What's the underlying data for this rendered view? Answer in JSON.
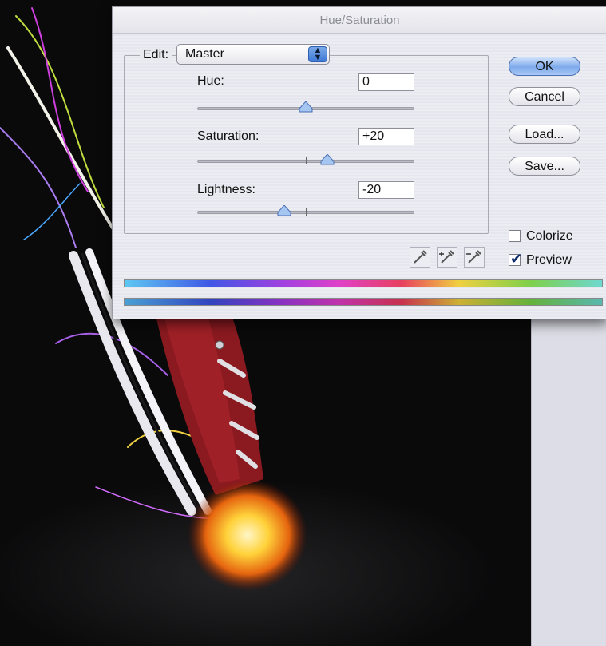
{
  "dialog": {
    "title": "Hue/Saturation",
    "edit_label": "Edit:",
    "edit_value": "Master",
    "hue": {
      "label": "Hue:",
      "value": "0",
      "position": 0.5
    },
    "saturation": {
      "label": "Saturation:",
      "value": "+20",
      "position": 0.6
    },
    "lightness": {
      "label": "Lightness:",
      "value": "-20",
      "position": 0.4
    },
    "buttons": {
      "ok": "OK",
      "cancel": "Cancel",
      "load": "Load...",
      "save": "Save..."
    },
    "colorize": {
      "label": "Colorize",
      "checked": false
    },
    "preview": {
      "label": "Preview",
      "checked": true
    }
  },
  "icons": [
    "eyedropper-icon",
    "eyedropper-plus-icon",
    "eyedropper-minus-icon",
    "select-arrows-icon",
    "checkmark-icon"
  ],
  "colors": {
    "ok_button": "#7eaaeb",
    "sneaker": "#8a1a20",
    "background": "#0a0a0b"
  }
}
